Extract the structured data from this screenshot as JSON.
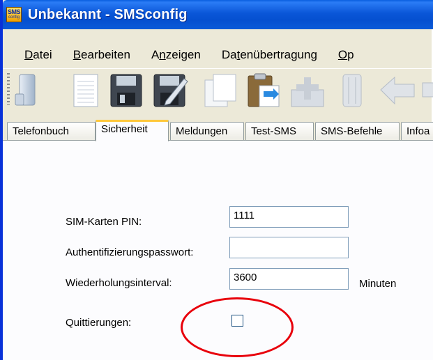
{
  "window": {
    "title": "Unbekannt - SMSconfig",
    "icon_top": "SMS",
    "icon_bottom": "config"
  },
  "menu": {
    "items": [
      {
        "label": "Datei",
        "mnemonic": "D",
        "rest": "atei"
      },
      {
        "label": "Bearbeiten",
        "mnemonic": "B",
        "rest": "earbeiten"
      },
      {
        "label": "Anzeigen",
        "pre": "A",
        "mnemonic": "n",
        "rest": "zeigen"
      },
      {
        "label": "Datenübertragung",
        "pre": "Da",
        "mnemonic": "t",
        "rest": "enübertragung"
      },
      {
        "label": "Op",
        "mnemonic": "O",
        "rest": "p"
      }
    ]
  },
  "toolbar": {
    "icons": [
      "phone-icon",
      "document-icon",
      "save-icon",
      "save-as-icon",
      "copy-icon",
      "paste-icon",
      "add-icon",
      "sim-icon",
      "back-arrow-icon"
    ]
  },
  "tabs": [
    {
      "label": "Telefonbuch",
      "active": false
    },
    {
      "label": "Sicherheit",
      "active": true
    },
    {
      "label": "Meldungen",
      "active": false
    },
    {
      "label": "Test-SMS",
      "active": false
    },
    {
      "label": "SMS-Befehle",
      "active": false
    },
    {
      "label": "Infoa",
      "active": false
    }
  ],
  "form": {
    "pin_label": "SIM-Karten PIN:",
    "pin_value": "1111",
    "auth_label": "Authentifizierungspasswort:",
    "auth_value": "",
    "interval_label": "Wiederholungsinterval:",
    "interval_value": "3600",
    "interval_unit": "Minuten",
    "ack_label": "Quittierungen:",
    "ack_checked": false
  },
  "colors": {
    "titlebar": "#0a56d8",
    "highlight_circle": "#e8000b",
    "active_tab_accent": "#ffc83c"
  }
}
